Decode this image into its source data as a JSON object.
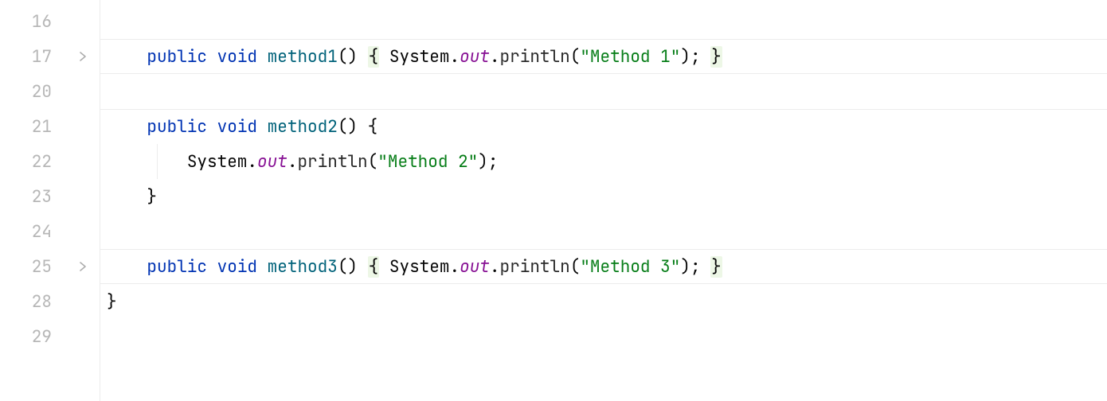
{
  "editor": {
    "rows": [
      {
        "n": "16",
        "fold": false,
        "ruleTop": false,
        "ruleBottom": false,
        "indent": 0,
        "tokens": []
      },
      {
        "n": "17",
        "fold": true,
        "ruleTop": true,
        "ruleBottom": true,
        "indent": 0,
        "tokens": [
          {
            "t": "    ",
            "c": ""
          },
          {
            "t": "public",
            "c": "kw"
          },
          {
            "t": " ",
            "c": ""
          },
          {
            "t": "void",
            "c": "kw"
          },
          {
            "t": " ",
            "c": ""
          },
          {
            "t": "method1",
            "c": "id"
          },
          {
            "t": "()",
            "c": "punct"
          },
          {
            "t": " ",
            "c": ""
          },
          {
            "t": "{",
            "c": "punct",
            "h": true
          },
          {
            "t": " ",
            "c": ""
          },
          {
            "t": "System",
            "c": "cls"
          },
          {
            "t": ".",
            "c": "punct"
          },
          {
            "t": "out",
            "c": "fld-i"
          },
          {
            "t": ".",
            "c": "punct"
          },
          {
            "t": "println",
            "c": "call"
          },
          {
            "t": "(",
            "c": "punct"
          },
          {
            "t": "\"Method 1\"",
            "c": "str"
          },
          {
            "t": ")",
            "c": "punct"
          },
          {
            "t": ";",
            "c": "punct"
          },
          {
            "t": " ",
            "c": ""
          },
          {
            "t": "}",
            "c": "punct",
            "h": true
          }
        ]
      },
      {
        "n": "20",
        "fold": false,
        "ruleTop": false,
        "ruleBottom": false,
        "indent": 0,
        "tokens": []
      },
      {
        "n": "21",
        "fold": false,
        "ruleTop": true,
        "ruleBottom": false,
        "indent": 0,
        "tokens": [
          {
            "t": "    ",
            "c": ""
          },
          {
            "t": "public",
            "c": "kw"
          },
          {
            "t": " ",
            "c": ""
          },
          {
            "t": "void",
            "c": "kw"
          },
          {
            "t": " ",
            "c": ""
          },
          {
            "t": "method2",
            "c": "id"
          },
          {
            "t": "()",
            "c": "punct"
          },
          {
            "t": " ",
            "c": ""
          },
          {
            "t": "{",
            "c": "punct"
          }
        ]
      },
      {
        "n": "22",
        "fold": false,
        "ruleTop": false,
        "ruleBottom": false,
        "indent": 1,
        "tokens": [
          {
            "t": "        ",
            "c": ""
          },
          {
            "t": "System",
            "c": "cls"
          },
          {
            "t": ".",
            "c": "punct"
          },
          {
            "t": "out",
            "c": "fld-i"
          },
          {
            "t": ".",
            "c": "punct"
          },
          {
            "t": "println",
            "c": "call"
          },
          {
            "t": "(",
            "c": "punct"
          },
          {
            "t": "\"Method 2\"",
            "c": "str"
          },
          {
            "t": ")",
            "c": "punct"
          },
          {
            "t": ";",
            "c": "punct"
          }
        ]
      },
      {
        "n": "23",
        "fold": false,
        "ruleTop": false,
        "ruleBottom": false,
        "indent": 0,
        "tokens": [
          {
            "t": "    ",
            "c": ""
          },
          {
            "t": "}",
            "c": "punct"
          }
        ]
      },
      {
        "n": "24",
        "fold": false,
        "ruleTop": false,
        "ruleBottom": false,
        "indent": 0,
        "tokens": []
      },
      {
        "n": "25",
        "fold": true,
        "ruleTop": true,
        "ruleBottom": true,
        "indent": 0,
        "tokens": [
          {
            "t": "    ",
            "c": ""
          },
          {
            "t": "public",
            "c": "kw"
          },
          {
            "t": " ",
            "c": ""
          },
          {
            "t": "void",
            "c": "kw"
          },
          {
            "t": " ",
            "c": ""
          },
          {
            "t": "method3",
            "c": "id"
          },
          {
            "t": "()",
            "c": "punct"
          },
          {
            "t": " ",
            "c": ""
          },
          {
            "t": "{",
            "c": "punct",
            "h": true
          },
          {
            "t": " ",
            "c": ""
          },
          {
            "t": "System",
            "c": "cls"
          },
          {
            "t": ".",
            "c": "punct"
          },
          {
            "t": "out",
            "c": "fld-i"
          },
          {
            "t": ".",
            "c": "punct"
          },
          {
            "t": "println",
            "c": "call"
          },
          {
            "t": "(",
            "c": "punct"
          },
          {
            "t": "\"Method 3\"",
            "c": "str"
          },
          {
            "t": ")",
            "c": "punct"
          },
          {
            "t": ";",
            "c": "punct"
          },
          {
            "t": " ",
            "c": ""
          },
          {
            "t": "}",
            "c": "punct",
            "h": true
          }
        ]
      },
      {
        "n": "28",
        "fold": false,
        "ruleTop": false,
        "ruleBottom": false,
        "indent": 0,
        "tokens": [
          {
            "t": "}",
            "c": "punct"
          }
        ]
      },
      {
        "n": "29",
        "fold": false,
        "ruleTop": false,
        "ruleBottom": false,
        "indent": 0,
        "tokens": []
      }
    ]
  }
}
